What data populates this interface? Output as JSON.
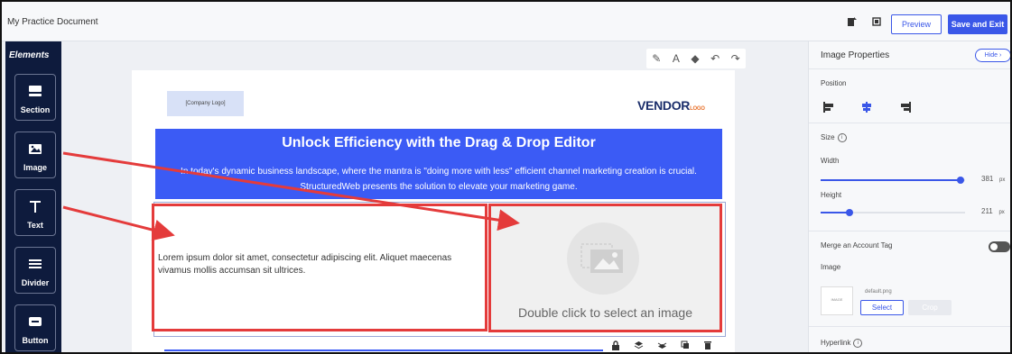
{
  "header": {
    "doc_title": "My Practice Document",
    "preview_label": "Preview",
    "save_exit_label": "Save and Exit"
  },
  "sidebar": {
    "title": "Elements",
    "items": [
      {
        "label": "Section",
        "icon": "section-icon"
      },
      {
        "label": "Image",
        "icon": "image-icon"
      },
      {
        "label": "Text",
        "icon": "text-icon"
      },
      {
        "label": "Divider",
        "icon": "divider-icon"
      },
      {
        "label": "Button",
        "icon": "button-icon"
      }
    ]
  },
  "email": {
    "logo_placeholder": "[Company Logo]",
    "vendor_name": "VENDOR",
    "vendor_suffix": "LOGO",
    "hero_title": "Unlock Efficiency with the Drag & Drop Editor",
    "hero_text": "In today's dynamic business landscape, where the mantra is \"doing more with less\" efficient channel marketing creation is crucial. StructuredWeb presents the solution to elevate your marketing game.",
    "body_text": "Lorem ipsum dolor sit amet, consectetur adipiscing elit. Aliquet maecenas vivamus mollis accumsan sit ultrices.",
    "image_caption": "Double click to select an image"
  },
  "properties": {
    "title": "Image Properties",
    "hide_label": "Hide",
    "position_label": "Position",
    "size_label": "Size",
    "width_label": "Width",
    "width_value": "381",
    "width_fill": 0.97,
    "height_label": "Height",
    "height_value": "211",
    "height_fill": 0.2,
    "unit": "px",
    "merge_tag_label": "Merge an Account Tag",
    "image_label": "Image",
    "file_name": "default.png",
    "thumb_text": "IMAGE",
    "select_label": "Select",
    "crop_label": "Crop",
    "hyperlink_label": "Hyperlink"
  },
  "colors": {
    "accent": "#3a57e8",
    "hero": "#3b5bf5",
    "sidebar": "#0e1b3d",
    "annotation": "#e43b3b"
  }
}
